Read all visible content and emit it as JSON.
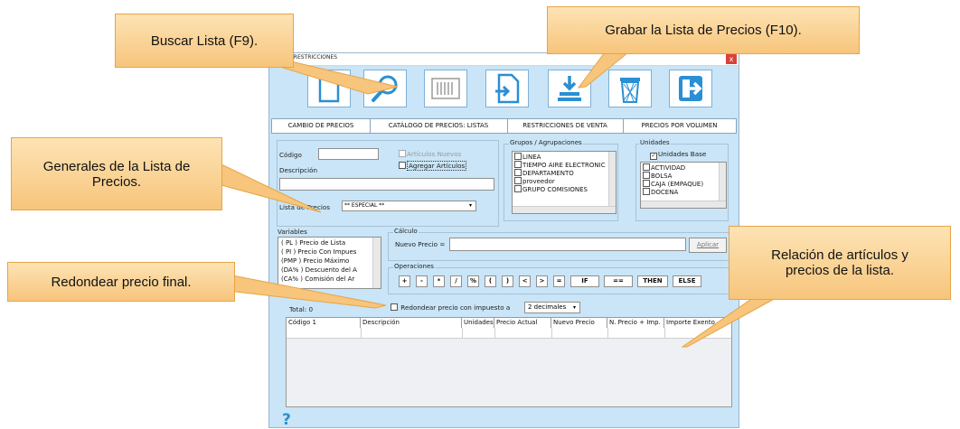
{
  "window": {
    "title": "…IOS Y RESTRICCIONES",
    "close_glyph": "x"
  },
  "toolbar": {
    "buttons": [
      {
        "name": "new-document-icon"
      },
      {
        "name": "search-icon"
      },
      {
        "name": "barcode-icon"
      },
      {
        "name": "import-icon"
      },
      {
        "name": "save-download-icon"
      },
      {
        "name": "trash-icon"
      },
      {
        "name": "exit-icon"
      }
    ]
  },
  "tabs": [
    {
      "label": "CAMBIO DE PRECIOS"
    },
    {
      "label": "CATÁLOGO DE PRECIOS: LISTAS"
    },
    {
      "label": "RESTRICCIONES DE VENTA"
    },
    {
      "label": "PRECIOS POR VOLUMEN"
    }
  ],
  "general": {
    "codigo_label": "Código",
    "codigo_value": "",
    "articulos_nuevos_label": "Artículos Nuevos",
    "agregar_articulos_label": "Agregar Artículos",
    "descripcion_label": "Descripción",
    "descripcion_value": "",
    "lista_label": "Lista de Precios",
    "lista_value": "** ESPECIAL **"
  },
  "grupos": {
    "title": "Grupos / Agrupaciones",
    "items": [
      "LINEA",
      "TIEMPO AIRE ELECTRONIC",
      "DEPARTAMENTO",
      "proveedor",
      "GRUPO COMISIONES"
    ]
  },
  "unidades": {
    "title": "Unidades",
    "base_label": "Unidades Base",
    "base_checked": true,
    "items": [
      "ACTIVIDAD",
      "BOLSA",
      "CAJA (EMPAQUE)",
      "DOCENA"
    ]
  },
  "variables": {
    "title": "Variables",
    "items": [
      "( PL )  Precio de Lista",
      "( PI )  Precio Con Impues",
      "(PMP )  Precio Máximo",
      "(DA% )  Descuento del A",
      "(CA% )  Comisión del Ar"
    ]
  },
  "calculo": {
    "title": "Cálculo",
    "nuevo_precio_label": "Nuevo Precio =",
    "nuevo_precio_value": "",
    "aplicar_label": "Aplicar"
  },
  "operaciones": {
    "title": "Operaciones",
    "buttons": [
      "+",
      "-",
      "*",
      "/",
      "%",
      "(",
      ")",
      "<",
      ">",
      "=",
      "IF",
      "==",
      "THEN",
      "ELSE"
    ]
  },
  "total_label": "Total: 0",
  "redondear": {
    "label": "Redondear precio con impuesto a",
    "value": "2 decimales"
  },
  "grid": {
    "columns": [
      "Código 1",
      "Descripción",
      "Unidades",
      "Precio Actual",
      "Nuevo Precio",
      "N. Precio + Imp.",
      "Importe Exento"
    ]
  },
  "help_glyph": "?",
  "callouts": {
    "buscar": "Buscar Lista (F9).",
    "grabar": "Grabar la Lista de Precios (F10).",
    "generales": "Generales de la Lista de Precios.",
    "redondear": "Redondear precio final.",
    "relacion": "Relación de artículos y precios de la lista."
  },
  "colors": {
    "window_bg": "#c9e5f7",
    "icon_blue": "#2a8fd4",
    "callout_fill": "#f7c57c"
  }
}
